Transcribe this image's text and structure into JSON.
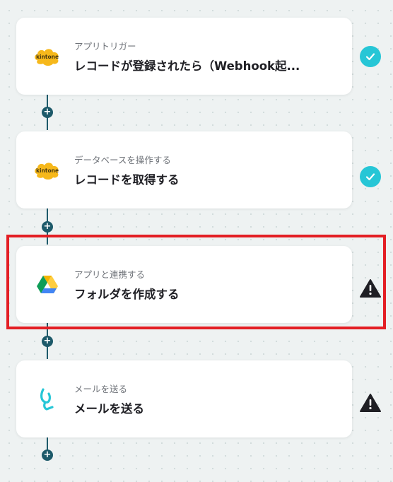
{
  "colors": {
    "accent_teal": "#26c6d6",
    "connector": "#1d5a6a",
    "highlight_red": "#e31e24",
    "kintone_yellow": "#f6b81b"
  },
  "steps": [
    {
      "subtitle": "アプリトリガー",
      "title": "レコードが登録されたら（Webhook起...",
      "logo": "kintone-logo",
      "logo_text": "kintone",
      "status": "check-icon"
    },
    {
      "subtitle": "データベースを操作する",
      "title": "レコードを取得する",
      "logo": "kintone-logo",
      "logo_text": "kintone",
      "status": "check-icon"
    },
    {
      "subtitle": "アプリと連携する",
      "title": "フォルダを作成する",
      "logo": "google-drive-icon",
      "status": "warning-icon"
    },
    {
      "subtitle": "メールを送る",
      "title": "メールを送る",
      "logo": "mail-app-icon",
      "status": "warning-icon"
    }
  ],
  "add_step_symbol": "+"
}
